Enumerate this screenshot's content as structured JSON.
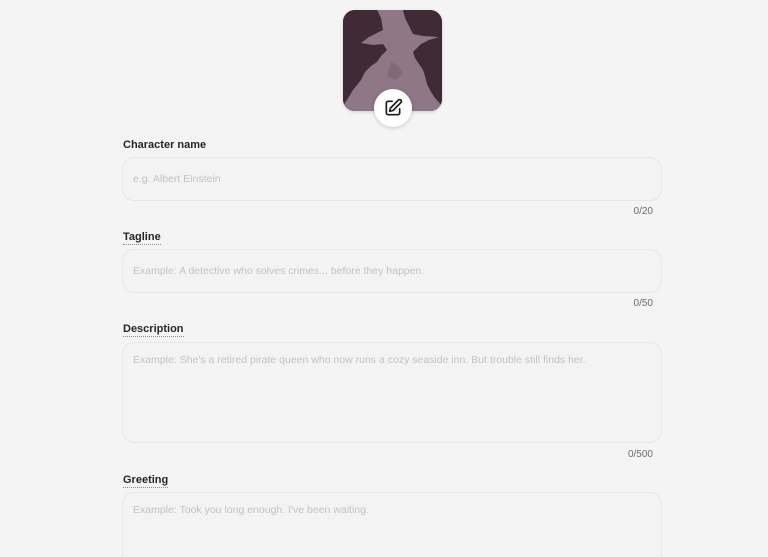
{
  "avatar": {
    "image": "silhouette-with-hat",
    "background_color": "#3f2a35",
    "silhouette_color": "#8f7785",
    "edit_icon": "pencil-square-icon"
  },
  "fields": {
    "name": {
      "label": "Character name",
      "placeholder": "e.g. Albert Einstein",
      "value": "",
      "counter": "0/20"
    },
    "tagline": {
      "label": "Tagline",
      "placeholder": "Example: A detective who solves crimes... before they happen.",
      "value": "",
      "counter": "0/50"
    },
    "description": {
      "label": "Description",
      "placeholder": "Example: She's a retired pirate queen who now runs a cozy seaside inn. But trouble still finds her.",
      "value": "",
      "counter": "0/500"
    },
    "greeting": {
      "label": "Greeting",
      "placeholder": "Example: Took you long enough. I've been waiting.",
      "value": ""
    }
  }
}
